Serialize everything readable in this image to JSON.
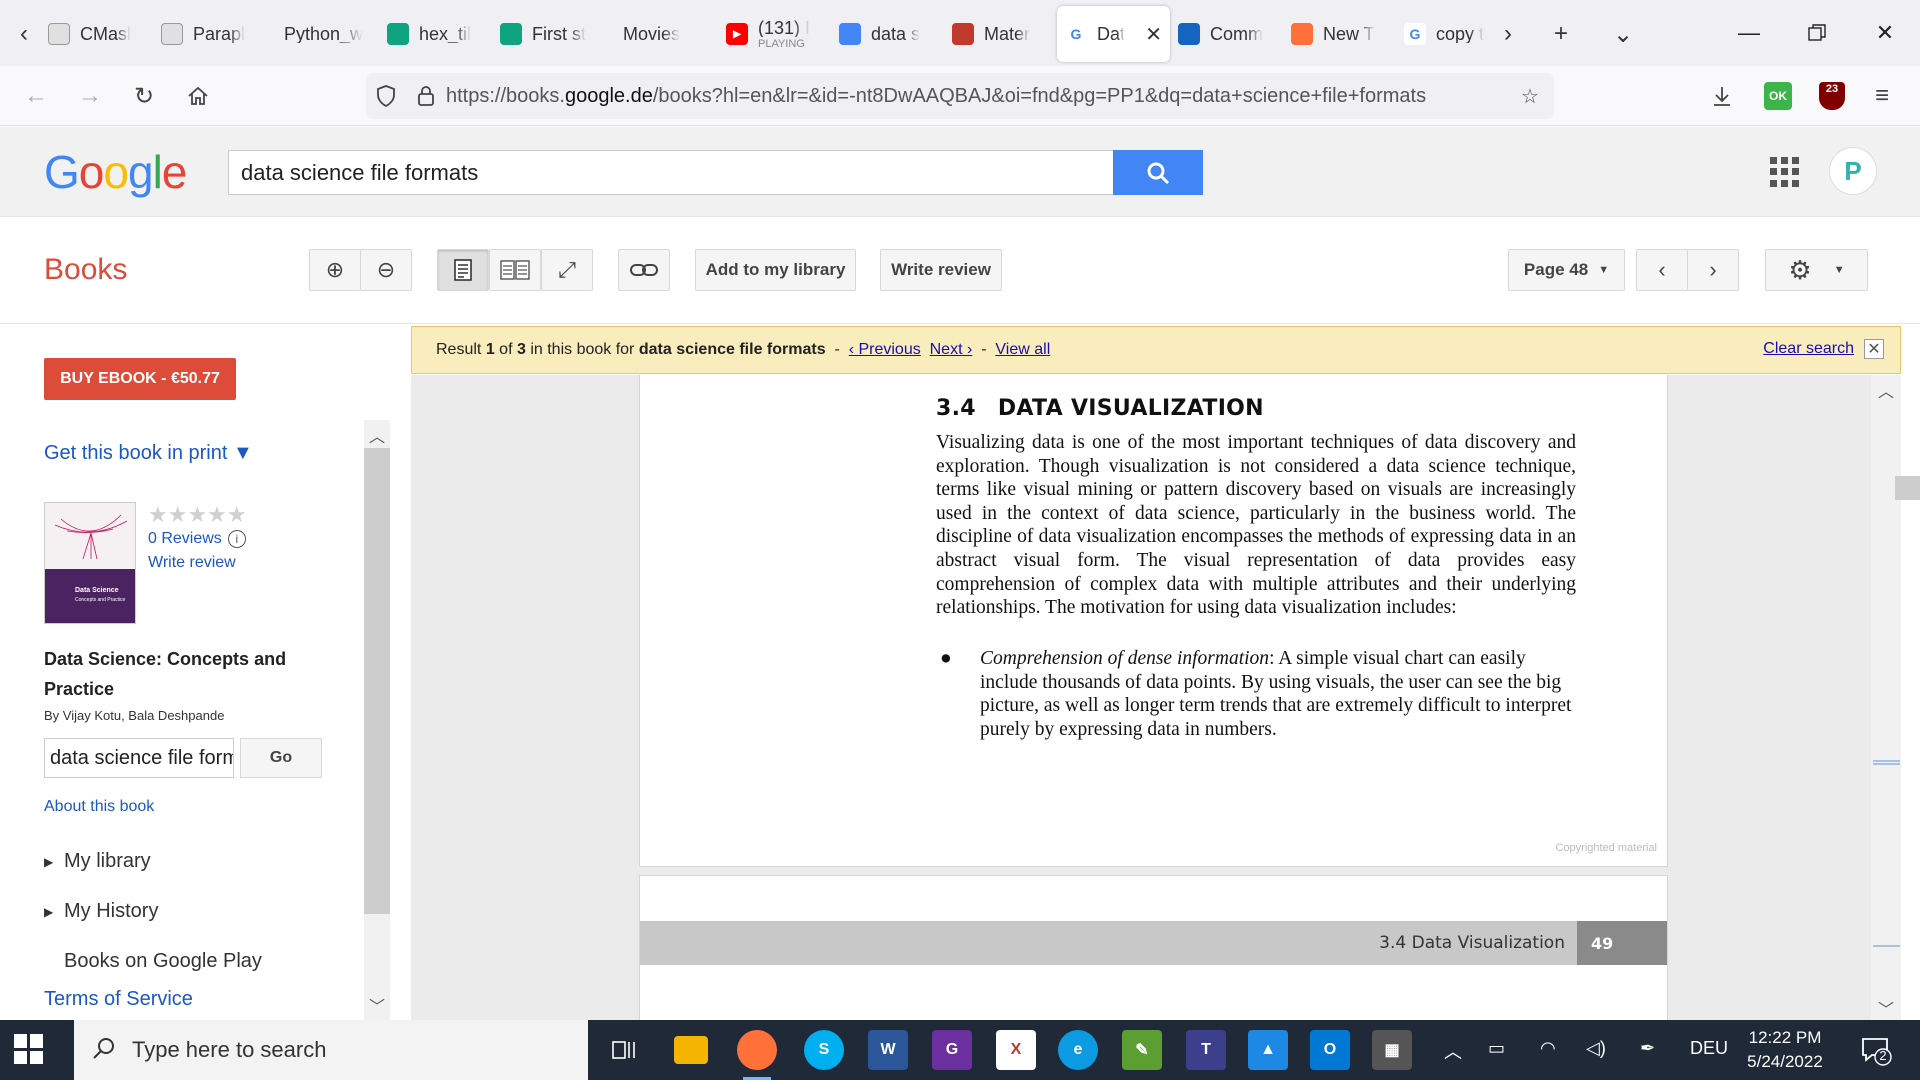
{
  "browser": {
    "tabs": [
      {
        "title": "CMasl",
        "icon": "page-icon",
        "color": "#e0e0e0"
      },
      {
        "title": "Parapl",
        "icon": "pen-icon",
        "color": "#e0e0e0"
      },
      {
        "title": "Python_w",
        "icon": "blank-icon",
        "color": "#f0f0f4"
      },
      {
        "title": "hex_til",
        "icon": "chatgpt-icon",
        "color": "#10a37f"
      },
      {
        "title": "First st",
        "icon": "chatgpt-icon",
        "color": "#10a37f"
      },
      {
        "title": "Movies",
        "icon": "blank-icon",
        "color": "#f0f0f4"
      },
      {
        "title": "(131) I",
        "subtitle": "PLAYING",
        "icon": "youtube-icon",
        "color": "#ff0000"
      },
      {
        "title": "data s",
        "icon": "diamond-icon",
        "color": "#4285f4"
      },
      {
        "title": "Mater",
        "icon": "grid-icon",
        "color": "#c0392b"
      },
      {
        "title": "Dat",
        "icon": "google-icon",
        "color": "#ffffff",
        "active": true
      },
      {
        "title": "Comm",
        "icon": "list-icon",
        "color": "#1565c0"
      },
      {
        "title": "New T",
        "icon": "firefox-icon",
        "color": "#ff7139"
      },
      {
        "title": "copy t",
        "icon": "google-icon",
        "color": "#ffffff"
      }
    ],
    "url_prefix": "https://books.",
    "url_domain": "google.de",
    "url_suffix": "/books?hl=en&lr=&id=-nt8DwAAQBAJ&oi=fnd&pg=PP1&dq=data+science+file+formats",
    "ext_badge_ok": "OK",
    "ext_badge_count": "23"
  },
  "google": {
    "logo": [
      "G",
      "o",
      "o",
      "g",
      "l",
      "e"
    ],
    "logo_colors": [
      "#4285f4",
      "#ea4335",
      "#fbbc05",
      "#4285f4",
      "#34a853",
      "#ea4335"
    ],
    "search_value": "data science file formats",
    "avatar_letter": "P"
  },
  "toolbar": {
    "section_title": "Books",
    "add_library": "Add to my library",
    "write_review": "Write review",
    "page_label": "Page 48"
  },
  "sidebar": {
    "buy_label": "BUY EBOOK - €50.77",
    "print_link": "Get this book in print ▼",
    "stars": "★★★★★",
    "reviews": "0 Reviews",
    "write_review": "Write review",
    "book_title": "Data Science: Concepts and Practice",
    "authors": "By Vijay Kotu, Bala Deshpande",
    "search_in_book": "data science file form",
    "go_label": "Go",
    "about": "About this book",
    "my_library": "My library",
    "my_history": "My History",
    "play": "Books on Google Play",
    "terms": "Terms of Service",
    "cover_title": "Data Science",
    "cover_subtitle": "Concepts and Practice"
  },
  "result": {
    "prefix": "Result",
    "index": "1",
    "of": "of",
    "total": "3",
    "mid": "in this book for",
    "query": "data science file formats",
    "prev": "‹ Previous",
    "next": "Next ›",
    "view_all": "View all",
    "clear": "Clear search"
  },
  "page": {
    "section_number": "3.4",
    "section_title": "DATA VISUALIZATION",
    "paragraph": "Visualizing data is one of the most important techniques of data discovery and exploration. Though visualization is not considered a data science technique, terms like visual mining or pattern discovery based on visuals are increasingly used in the context of data science, particularly in the business world. The discipline of data visualization encompasses the methods of expressing data in an abstract visual form. The visual representation of data provides easy comprehension of complex data with multiple attributes and their underlying relationships. The motivation for using data visualization includes:",
    "bullet_term": "Comprehension of dense information",
    "bullet_text": ": A simple visual chart can easily include thousands of data points. By using visuals, the user can see the big picture, as well as longer term trends that are extremely difficult to interpret purely by expressing data in numbers.",
    "copyright": "Copyrighted material",
    "running_head": "3.4  Data Visualization",
    "next_page_number": "49"
  },
  "taskbar": {
    "search_placeholder": "Type here to search",
    "language": "DEU",
    "time": "12:22 PM",
    "date": "5/24/2022",
    "notifications": "2"
  }
}
